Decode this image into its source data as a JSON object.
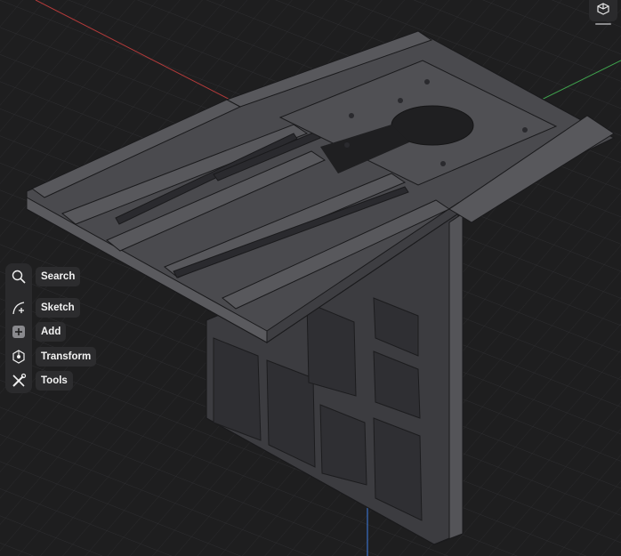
{
  "toolbar": {
    "items": [
      {
        "label": "Search",
        "icon": "search-icon"
      },
      {
        "label": "Sketch",
        "icon": "sketch-icon"
      },
      {
        "label": "Add",
        "icon": "add-icon"
      },
      {
        "label": "Transform",
        "icon": "transform-icon"
      },
      {
        "label": "Tools",
        "icon": "tools-icon"
      }
    ]
  },
  "viewport": {
    "background": "#1e1e1f",
    "grid_color": "#2e2e30",
    "x_axis_color": "#b33a3a",
    "y_axis_color": "#3fa34d",
    "z_axis_color": "#3a6fc4",
    "model_color": "#4a4a4e"
  },
  "view_cube": {
    "icon": "view-cube-icon"
  }
}
